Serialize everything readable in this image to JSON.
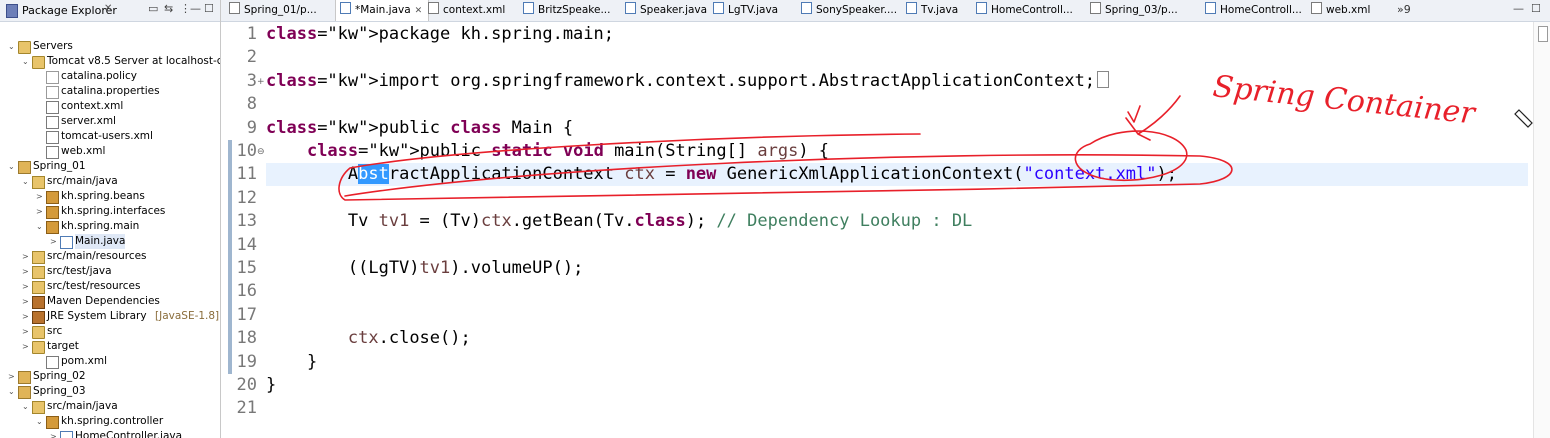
{
  "explorer": {
    "title": "Package Explorer",
    "close_glyph": "✕",
    "items": [
      {
        "label": "Servers",
        "icon": "folder",
        "twisty": "⌄",
        "indent": 0
      },
      {
        "label": "Tomcat v8.5 Server at localhost-config",
        "icon": "folder",
        "twisty": "⌄",
        "indent": 1
      },
      {
        "label": "catalina.policy",
        "icon": "file",
        "twisty": "",
        "indent": 2
      },
      {
        "label": "catalina.properties",
        "icon": "file",
        "twisty": "",
        "indent": 2
      },
      {
        "label": "context.xml",
        "icon": "xml",
        "twisty": "",
        "indent": 2
      },
      {
        "label": "server.xml",
        "icon": "xml",
        "twisty": "",
        "indent": 2
      },
      {
        "label": "tomcat-users.xml",
        "icon": "xml",
        "twisty": "",
        "indent": 2
      },
      {
        "label": "web.xml",
        "icon": "xml",
        "twisty": "",
        "indent": 2
      },
      {
        "label": "Spring_01",
        "icon": "proj",
        "twisty": "⌄",
        "indent": 0
      },
      {
        "label": "src/main/java",
        "icon": "src",
        "twisty": "⌄",
        "indent": 1
      },
      {
        "label": "kh.spring.beans",
        "icon": "pkg",
        "twisty": ">",
        "indent": 2
      },
      {
        "label": "kh.spring.interfaces",
        "icon": "pkg",
        "twisty": ">",
        "indent": 2
      },
      {
        "label": "kh.spring.main",
        "icon": "pkg",
        "twisty": "⌄",
        "indent": 2
      },
      {
        "label": "Main.java",
        "icon": "java",
        "twisty": ">",
        "indent": 3,
        "selected": true
      },
      {
        "label": "src/main/resources",
        "icon": "src",
        "twisty": ">",
        "indent": 1
      },
      {
        "label": "src/test/java",
        "icon": "src",
        "twisty": ">",
        "indent": 1
      },
      {
        "label": "src/test/resources",
        "icon": "src",
        "twisty": ">",
        "indent": 1
      },
      {
        "label": "Maven Dependencies",
        "icon": "lib",
        "twisty": ">",
        "indent": 1
      },
      {
        "label": "JRE System Library",
        "suffix": "[JavaSE-1.8]",
        "icon": "lib",
        "twisty": ">",
        "indent": 1
      },
      {
        "label": "src",
        "icon": "folder",
        "twisty": ">",
        "indent": 1
      },
      {
        "label": "target",
        "icon": "folder",
        "twisty": ">",
        "indent": 1
      },
      {
        "label": "pom.xml",
        "icon": "xml",
        "twisty": "",
        "indent": 2
      },
      {
        "label": "Spring_02",
        "icon": "proj",
        "twisty": ">",
        "indent": 0
      },
      {
        "label": "Spring_03",
        "icon": "proj",
        "twisty": "⌄",
        "indent": 0
      },
      {
        "label": "src/main/java",
        "icon": "src",
        "twisty": "⌄",
        "indent": 1
      },
      {
        "label": "kh.spring.controller",
        "icon": "pkg",
        "twisty": "⌄",
        "indent": 2
      },
      {
        "label": "HomeController.java",
        "icon": "java",
        "twisty": ">",
        "indent": 3
      }
    ]
  },
  "tabs": [
    {
      "label": "Spring_01/p...",
      "icon": "xml"
    },
    {
      "label": "*Main.java",
      "icon": "java",
      "active": true,
      "close": "✕"
    },
    {
      "label": "context.xml",
      "icon": "xml"
    },
    {
      "label": "BritzSpeake...",
      "icon": "java"
    },
    {
      "label": "Speaker.java",
      "icon": "java"
    },
    {
      "label": "LgTV.java",
      "icon": "java"
    },
    {
      "label": "SonySpeaker....",
      "icon": "java"
    },
    {
      "label": "Tv.java",
      "icon": "java"
    },
    {
      "label": "HomeControll...",
      "icon": "java"
    },
    {
      "label": "Spring_03/p...",
      "icon": "xml"
    },
    {
      "label": "HomeControll...",
      "icon": "java"
    },
    {
      "label": "web.xml",
      "icon": "xml"
    }
  ],
  "tabs_overflow": "»9",
  "editor": {
    "lines": [
      {
        "n": "1",
        "code": "package kh.spring.main;"
      },
      {
        "n": "2",
        "code": ""
      },
      {
        "n": "3",
        "code": "import org.springframework.context.support.AbstractApplicationContext;"
      },
      {
        "n": "8",
        "code": ""
      },
      {
        "n": "9",
        "code": "public class Main {"
      },
      {
        "n": "10",
        "code": "    public static void main(String[] args) {"
      },
      {
        "n": "11",
        "code": "        AbstractApplicationContext ctx = new GenericXmlApplicationContext(\"context.xml\");"
      },
      {
        "n": "12",
        "code": ""
      },
      {
        "n": "13",
        "code": "        Tv tv1 = (Tv)ctx.getBean(Tv.class); // Dependency Lookup : DL"
      },
      {
        "n": "14",
        "code": ""
      },
      {
        "n": "15",
        "code": "        ((LgTV)tv1).volumeUP();"
      },
      {
        "n": "16",
        "code": ""
      },
      {
        "n": "17",
        "code": ""
      },
      {
        "n": "18",
        "code": "        ctx.close();"
      },
      {
        "n": "19",
        "code": "    }"
      },
      {
        "n": "20",
        "code": "}"
      },
      {
        "n": "21",
        "code": ""
      }
    ],
    "current_line": "11"
  },
  "annotation": {
    "text": "Spring Container",
    "color": "#e8202a"
  },
  "colors": {
    "keyword": "#7f0055",
    "string": "#2a00ff",
    "comment": "#3f7f5f",
    "current_line_bg": "#e8f2fe",
    "selection": "#3399ff"
  }
}
